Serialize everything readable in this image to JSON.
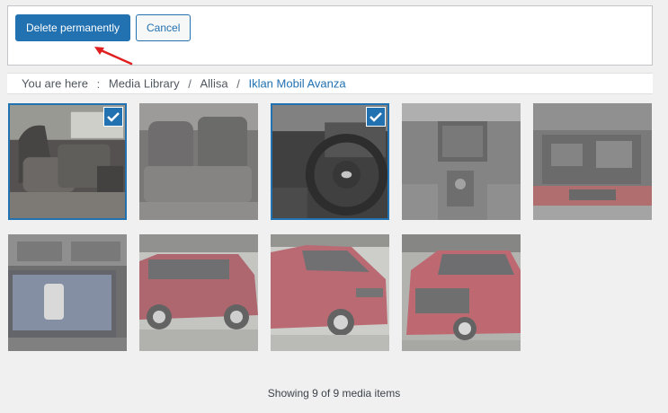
{
  "toolbar": {
    "delete_label": "Delete permanently",
    "cancel_label": "Cancel"
  },
  "annotation": {
    "arrow_color": "#e02020"
  },
  "breadcrumb": {
    "prefix": "You are here",
    "colon": ":",
    "separator": "/",
    "items": [
      "Media Library",
      "Allisa",
      "Iklan Mobil Avanza"
    ]
  },
  "media": {
    "items": [
      {
        "subject": "car interior rear seats",
        "selected": true
      },
      {
        "subject": "car interior seats dim",
        "selected": false
      },
      {
        "subject": "steering wheel dashboard",
        "selected": true
      },
      {
        "subject": "center console gear shift",
        "selected": false
      },
      {
        "subject": "engine bay under hood",
        "selected": false
      },
      {
        "subject": "head unit parking camera screen",
        "selected": false
      },
      {
        "subject": "red minivan side view",
        "selected": false
      },
      {
        "subject": "red minivan front three-quarter",
        "selected": false
      },
      {
        "subject": "red minivan front view",
        "selected": false
      }
    ],
    "accent_color": "#2271b1"
  },
  "status": {
    "text": "Showing 9 of 9 media items"
  }
}
